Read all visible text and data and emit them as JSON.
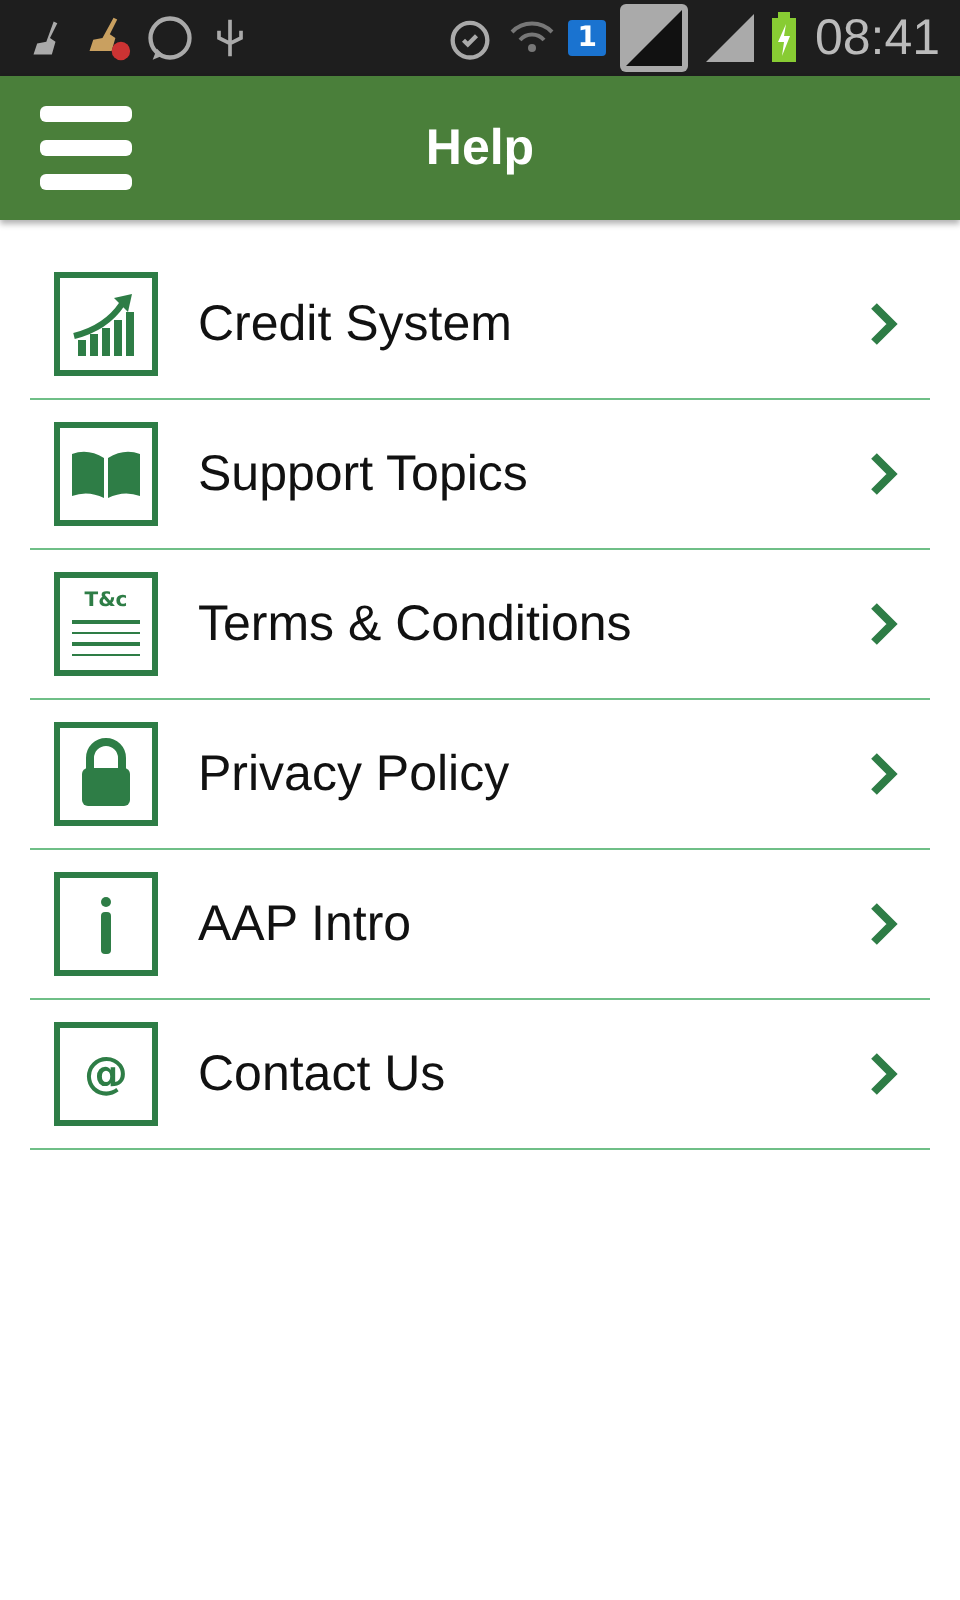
{
  "status_bar": {
    "sim_label": "1",
    "time": "08:41"
  },
  "app_bar": {
    "title": "Help"
  },
  "items": [
    {
      "label": "Credit System",
      "kind": "chart"
    },
    {
      "label": "Support Topics",
      "kind": "book"
    },
    {
      "label": "Terms & Conditions",
      "kind": "terms",
      "icon_text": "T&c"
    },
    {
      "label": "Privacy Policy",
      "kind": "lock"
    },
    {
      "label": "AAP Intro",
      "kind": "info"
    },
    {
      "label": "Contact Us",
      "kind": "at",
      "icon_text": "@"
    }
  ]
}
